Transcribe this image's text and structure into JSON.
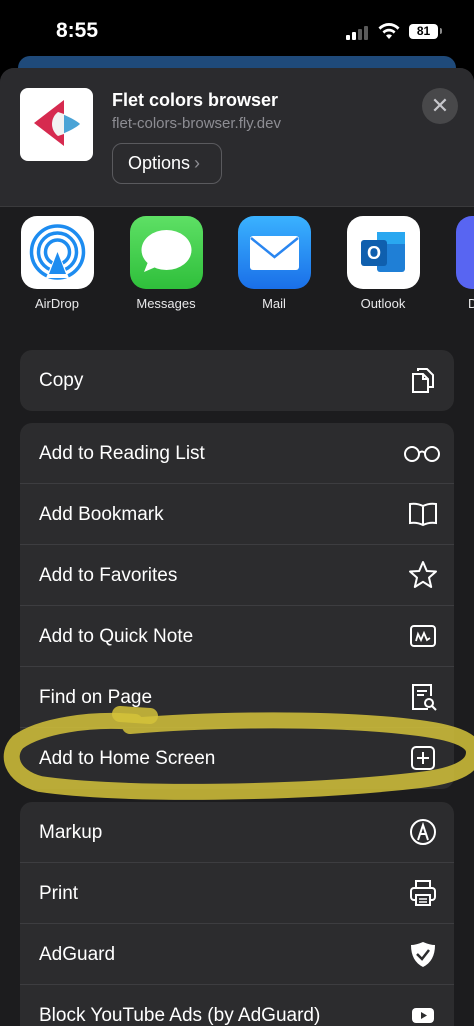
{
  "status_bar": {
    "time": "8:55",
    "battery": "81"
  },
  "share_sheet": {
    "site_title": "Flet colors browser",
    "site_url": "flet-colors-browser.fly.dev",
    "options_label": "Options",
    "options_chevron": "›",
    "close_glyph": "✕"
  },
  "apps": [
    {
      "label": "AirDrop",
      "icon": "airdrop-icon"
    },
    {
      "label": "Messages",
      "icon": "messages-icon"
    },
    {
      "label": "Mail",
      "icon": "mail-icon"
    },
    {
      "label": "Outlook",
      "icon": "outlook-icon"
    },
    {
      "label": "D",
      "icon": "partial-app-icon"
    }
  ],
  "actions_group1": [
    {
      "label": "Copy",
      "icon": "copy-icon"
    }
  ],
  "actions_group2": [
    {
      "label": "Add to Reading List",
      "icon": "glasses-icon"
    },
    {
      "label": "Add Bookmark",
      "icon": "book-icon"
    },
    {
      "label": "Add to Favorites",
      "icon": "star-icon"
    },
    {
      "label": "Add to Quick Note",
      "icon": "quick-note-icon"
    },
    {
      "label": "Find on Page",
      "icon": "find-icon"
    },
    {
      "label": "Add to Home Screen",
      "icon": "plus-square-icon"
    }
  ],
  "actions_group3": [
    {
      "label": "Markup",
      "icon": "markup-icon"
    },
    {
      "label": "Print",
      "icon": "printer-icon"
    },
    {
      "label": "AdGuard",
      "icon": "shield-check-icon"
    },
    {
      "label": "Block YouTube Ads (by AdGuard)",
      "icon": "youtube-icon"
    }
  ],
  "colors": {
    "sheet_bg": "#1c1c1e",
    "row_bg": "#2c2c2e",
    "highlight": "#d4c23a"
  }
}
